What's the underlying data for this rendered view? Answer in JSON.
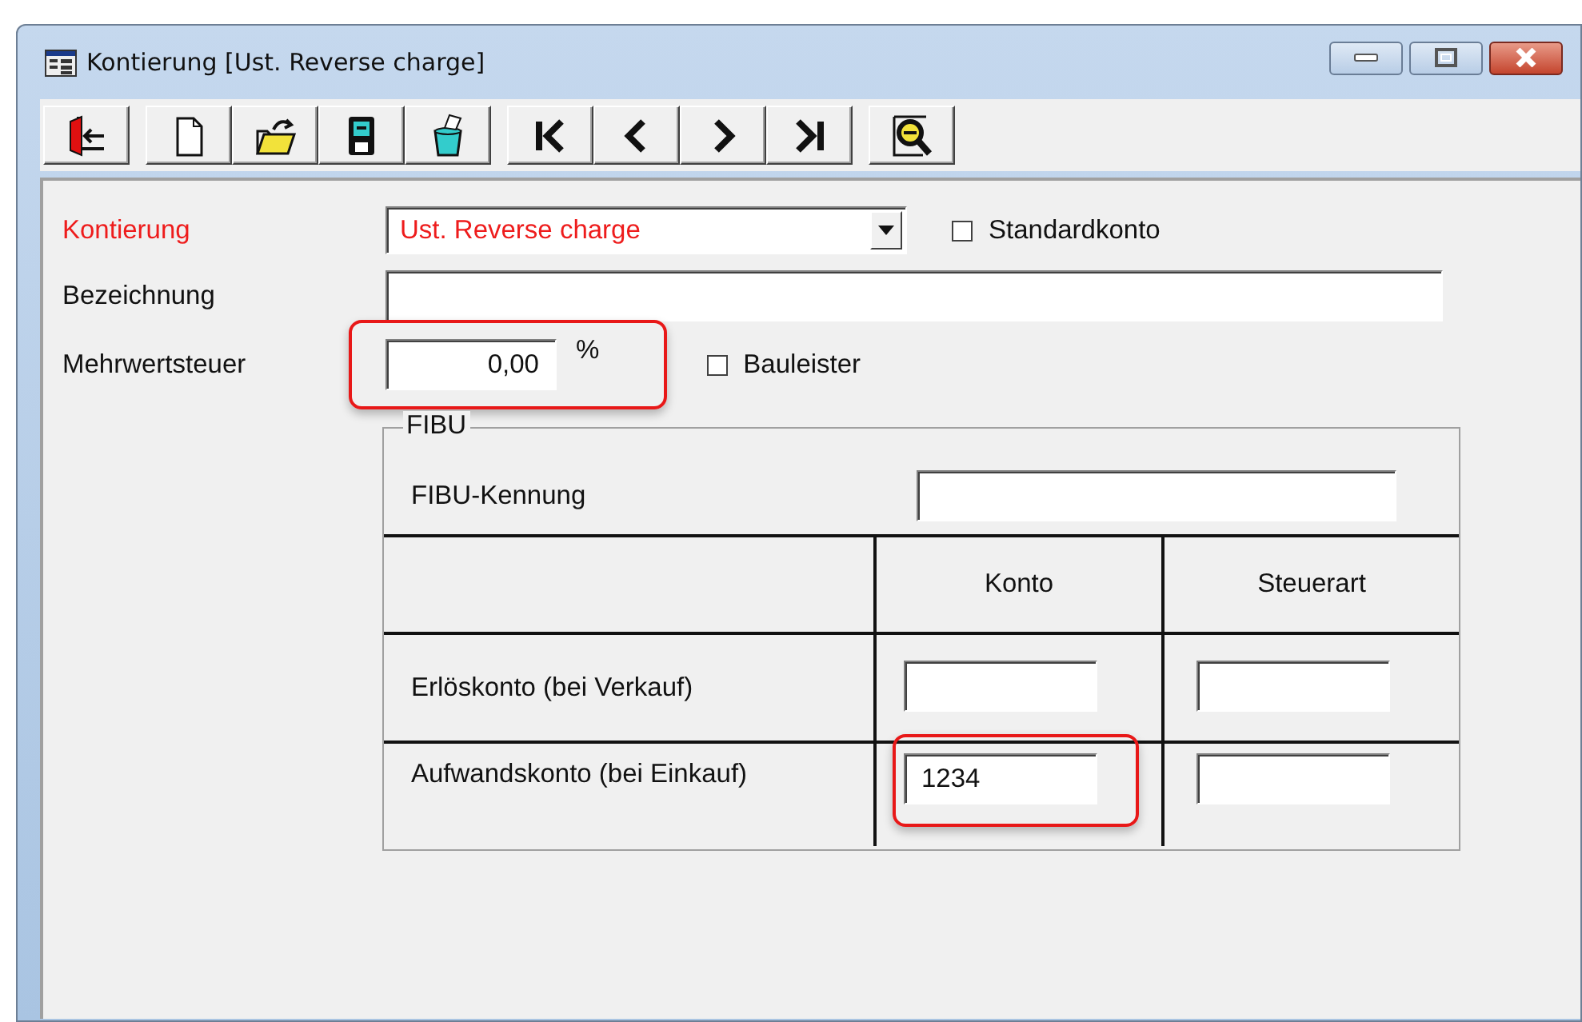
{
  "window": {
    "title": "Kontierung [Ust. Reverse charge]"
  },
  "form": {
    "kontierung": {
      "label": "Kontierung",
      "value": "Ust. Reverse charge",
      "required": true
    },
    "standardkonto": {
      "label": "Standardkonto",
      "checked": false
    },
    "bezeichnung": {
      "label": "Bezeichnung"
    },
    "mehrwertsteuer": {
      "label": "Mehrwertsteuer",
      "value": "0,00",
      "unit": "%",
      "highlighted": true
    },
    "bauleister": {
      "label": "Bauleister",
      "checked": false
    }
  },
  "fibu": {
    "title": "FIBU",
    "kennung_label": "FIBU-Kennung",
    "columns": [
      "Konto",
      "Steuerart"
    ],
    "rows": [
      {
        "label": "Erlöskonto (bei Verkauf)",
        "konto_highlighted": false
      },
      {
        "label": "Aufwandskonto (bei Einkauf)",
        "konto": "1234",
        "konto_highlighted": true
      }
    ]
  }
}
